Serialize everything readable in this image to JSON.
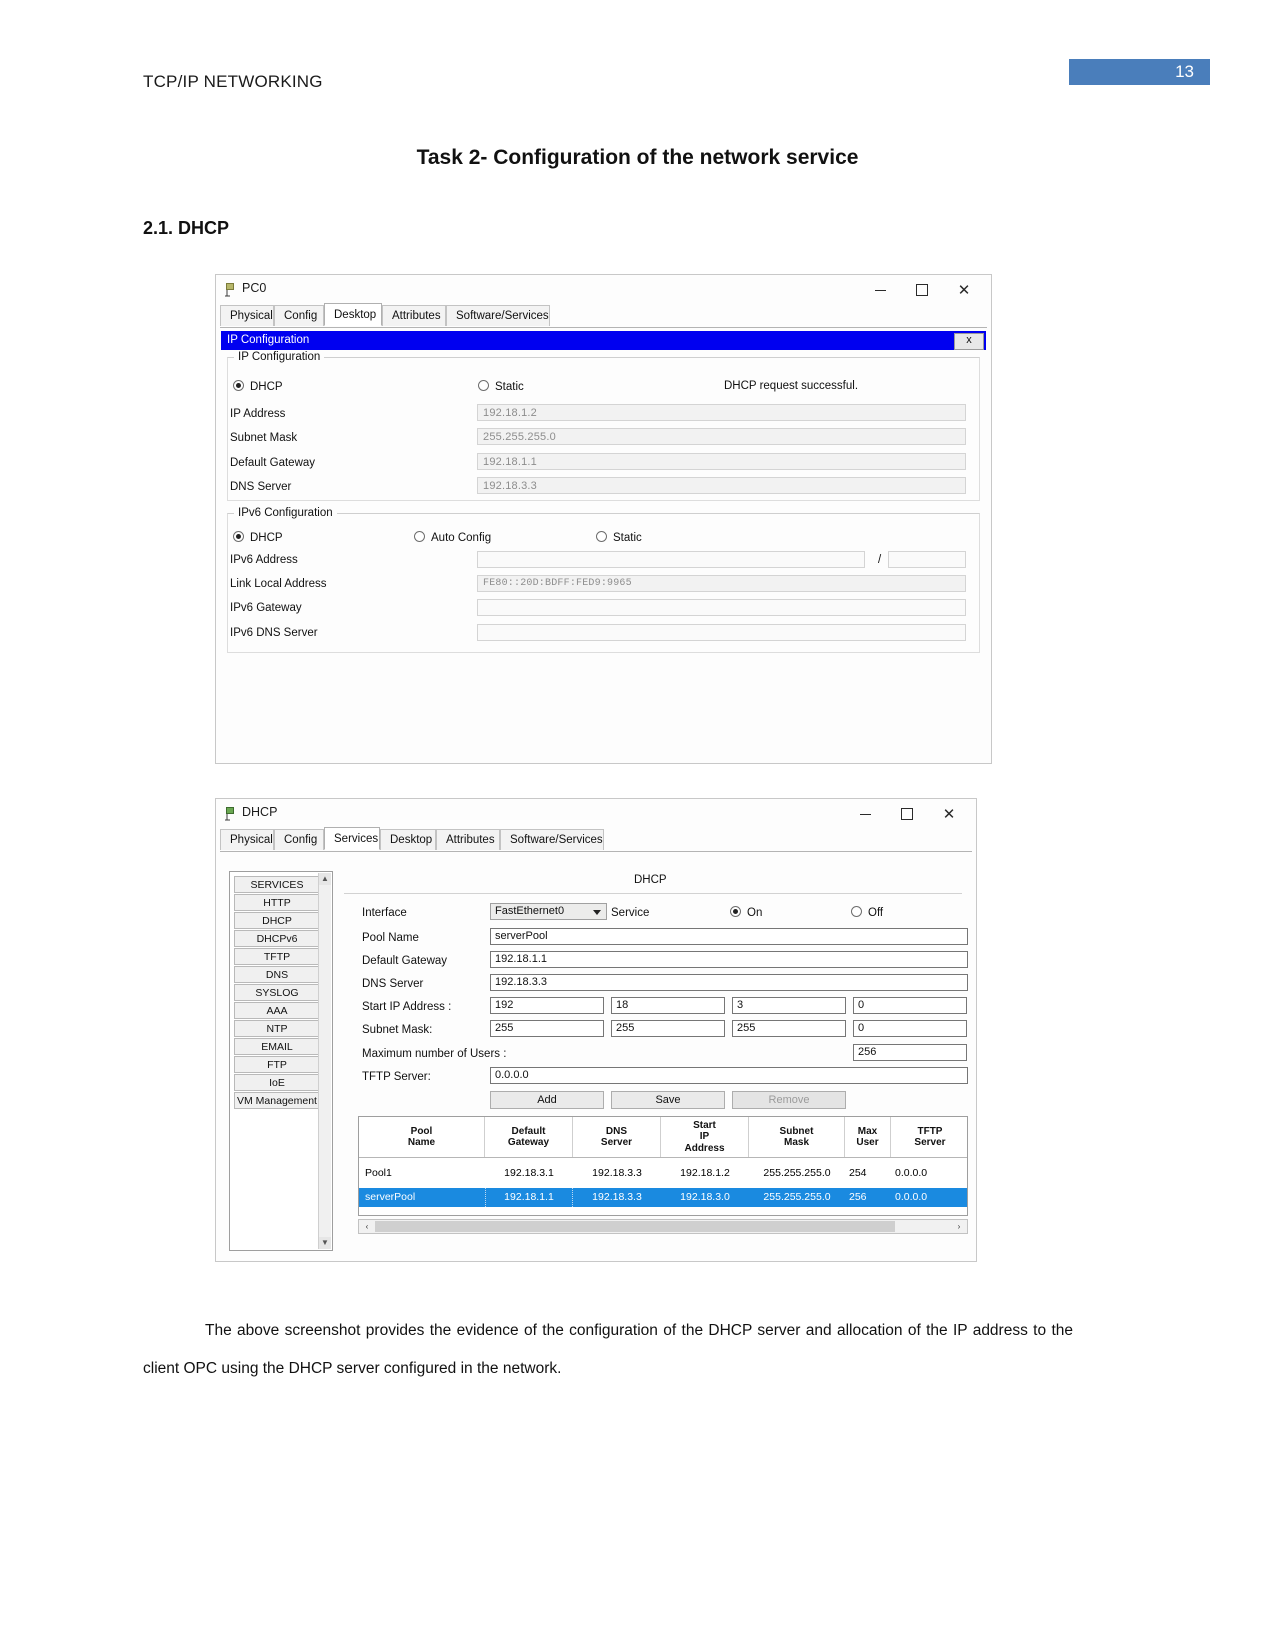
{
  "document": {
    "header_left": "TCP/IP NETWORKING",
    "page_number": "13",
    "title": "Task 2- Configuration of the network service",
    "subtitle": "2.1. DHCP",
    "paragraph": "The above screenshot provides the evidence of the configuration of the DHCP server and allocation of the IP address to the client OPC using the DHCP server configured in the network."
  },
  "pc_window": {
    "title": "PC0",
    "minimize": "—",
    "maximize": "❐",
    "close": "✕",
    "tabs": [
      {
        "label": "Physical",
        "active": false
      },
      {
        "label": "Config",
        "active": false
      },
      {
        "label": "Desktop",
        "active": true
      },
      {
        "label": "Attributes",
        "active": false
      },
      {
        "label": "Software/Services",
        "active": false
      }
    ],
    "dialog": {
      "titlebar": "IP Configuration",
      "close_label": "x"
    },
    "ipv4": {
      "legend": "IP Configuration",
      "mode_dhcp": "DHCP",
      "mode_static": "Static",
      "status": "DHCP request successful.",
      "fields": [
        {
          "label": "IP Address",
          "value": "192.18.1.2"
        },
        {
          "label": "Subnet Mask",
          "value": "255.255.255.0"
        },
        {
          "label": "Default Gateway",
          "value": "192.18.1.1"
        },
        {
          "label": "DNS Server",
          "value": "192.18.3.3"
        }
      ]
    },
    "ipv6": {
      "legend": "IPv6 Configuration",
      "mode_dhcp": "DHCP",
      "mode_auto": "Auto Config",
      "mode_static": "Static",
      "address_label": "IPv6 Address",
      "address_value": "",
      "prefix_separator": "/",
      "prefix_value": "",
      "link_local_label": "Link Local Address",
      "link_local_value": "FE80::20D:BDFF:FED9:9965",
      "gateway_label": "IPv6 Gateway",
      "gateway_value": "",
      "dns_label": "IPv6 DNS Server",
      "dns_value": ""
    }
  },
  "dhcp_window": {
    "title": "DHCP",
    "minimize": "—",
    "maximize": "❐",
    "close": "✕",
    "tabs": [
      {
        "label": "Physical",
        "active": false
      },
      {
        "label": "Config",
        "active": false
      },
      {
        "label": "Services",
        "active": true
      },
      {
        "label": "Desktop",
        "active": false
      },
      {
        "label": "Attributes",
        "active": false
      },
      {
        "label": "Software/Services",
        "active": false
      }
    ],
    "services_list": [
      "SERVICES",
      "HTTP",
      "DHCP",
      "DHCPv6",
      "TFTP",
      "DNS",
      "SYSLOG",
      "AAA",
      "NTP",
      "EMAIL",
      "FTP",
      "IoE",
      "VM Management"
    ],
    "panel_title": "DHCP",
    "form": {
      "interface_label": "Interface",
      "interface_value": "FastEthernet0",
      "service_label": "Service",
      "service_on": "On",
      "service_off": "Off",
      "pool_name_label": "Pool Name",
      "pool_name_value": "serverPool",
      "default_gateway_label": "Default Gateway",
      "default_gateway_value": "192.18.1.1",
      "dns_server_label": "DNS Server",
      "dns_server_value": "192.18.3.3",
      "start_ip_label": "Start IP Address :",
      "start_ip_octets": [
        "192",
        "18",
        "3",
        "0"
      ],
      "subnet_mask_label": "Subnet Mask:",
      "subnet_mask_octets": [
        "255",
        "255",
        "255",
        "0"
      ],
      "max_users_label": "Maximum number of Users :",
      "max_users_value": "256",
      "tftp_label": "TFTP Server:",
      "tftp_value": "0.0.0.0"
    },
    "buttons": {
      "add": "Add",
      "save": "Save",
      "remove": "Remove"
    },
    "table": {
      "headers": [
        "Pool\nName",
        "Default\nGateway",
        "DNS\nServer",
        "Start\nIP\nAddress",
        "Subnet\nMask",
        "Max\nUser",
        "TFTP\nServer"
      ],
      "rows": [
        {
          "selected": false,
          "cells": [
            "Pool1",
            "192.18.3.1",
            "192.18.3.3",
            "192.18.1.2",
            "255.255.255.0",
            "254",
            "0.0.0.0"
          ]
        },
        {
          "selected": true,
          "cells": [
            "serverPool",
            "192.18.1.1",
            "192.18.3.3",
            "192.18.3.0",
            "255.255.255.0",
            "256",
            "0.0.0.0"
          ]
        }
      ]
    },
    "scroll": {
      "left_arrow": "‹",
      "right_arrow": "›"
    }
  },
  "colors": {
    "page_badge": "#4a7ebb",
    "dialog_titlebar": "#0000f0",
    "row_selected": "#1a8ae0"
  }
}
